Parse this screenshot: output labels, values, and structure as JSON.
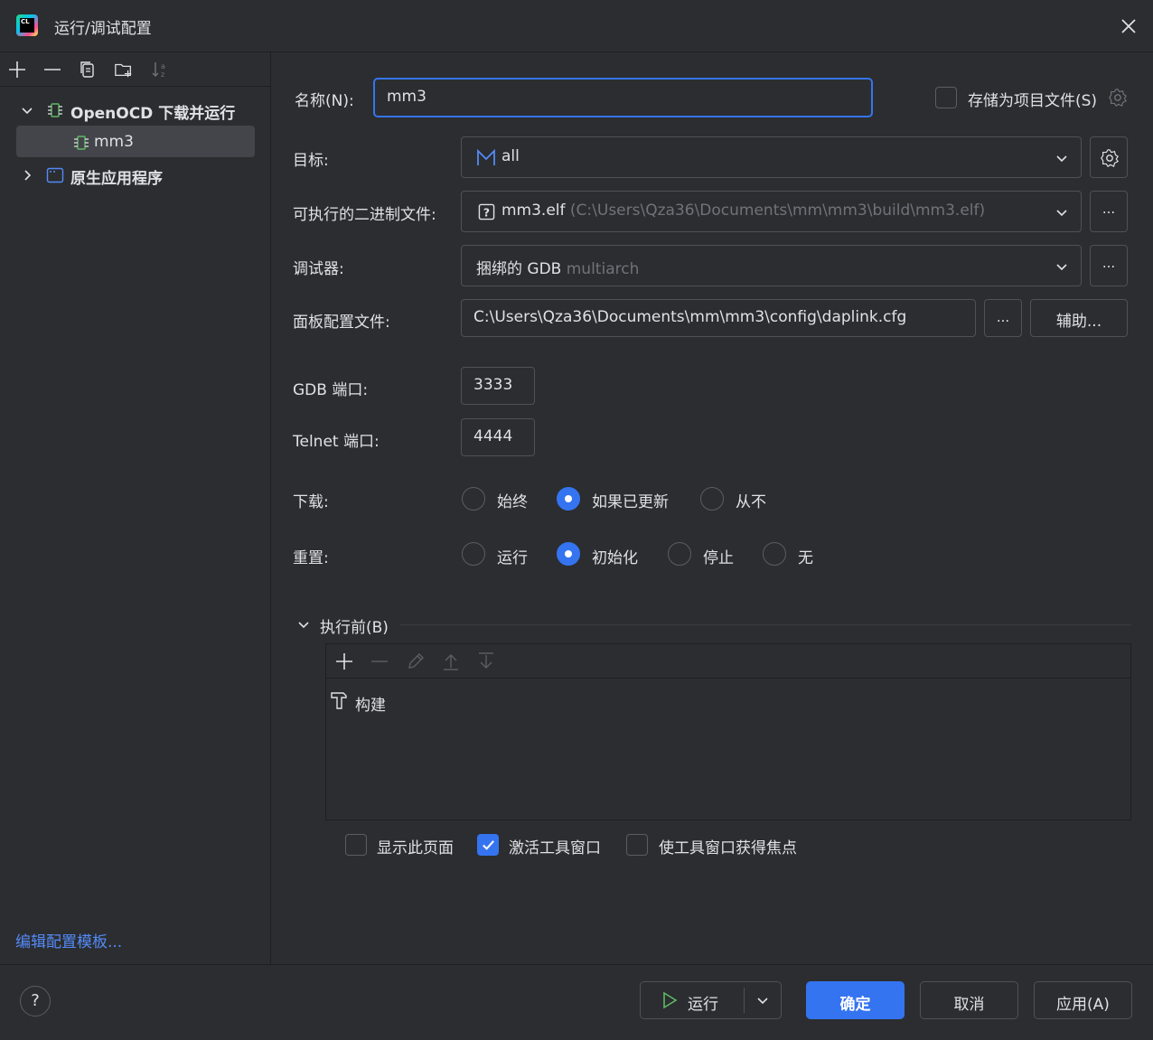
{
  "window": {
    "title": "运行/调试配置",
    "logo_text": "CL"
  },
  "sidebar": {
    "tree": [
      {
        "label": "OpenOCD 下载并运行",
        "expanded": true
      },
      {
        "label": "mm3",
        "selected": true
      },
      {
        "label": "原生应用程序",
        "expanded": false
      }
    ],
    "edit_templates_link": "编辑配置模板..."
  },
  "form": {
    "name_label": "名称(N):",
    "name_value": "mm3",
    "store_as_project_file": "存储为项目文件(S)",
    "target_label": "目标:",
    "target_value": "all",
    "executable_label": "可执行的二进制文件:",
    "executable_value": "mm3.elf",
    "executable_hint": "(C:\\Users\\Qza36\\Documents\\mm\\mm3\\build\\mm3.elf)",
    "debugger_label": "调试器:",
    "debugger_value": "捆绑的 GDB",
    "debugger_hint": "multiarch",
    "board_config_label": "面板配置文件:",
    "board_config_value": "C:\\Users\\Qza36\\Documents\\mm\\mm3\\config\\daplink.cfg",
    "browse_label": "...",
    "assist_label": "辅助...",
    "gdb_port_label": "GDB 端口:",
    "gdb_port_value": "3333",
    "telnet_port_label": "Telnet 端口:",
    "telnet_port_value": "4444",
    "download_label": "下载:",
    "download_options": [
      "始终",
      "如果已更新",
      "从不"
    ],
    "download_selected": "如果已更新",
    "reset_label": "重置:",
    "reset_options": [
      "运行",
      "初始化",
      "停止",
      "无"
    ],
    "reset_selected": "初始化"
  },
  "before_launch": {
    "title": "执行前(B)",
    "tasks": [
      "构建"
    ],
    "checkboxes": [
      {
        "label": "显示此页面",
        "checked": false
      },
      {
        "label": "激活工具窗口",
        "checked": true
      },
      {
        "label": "使工具窗口获得焦点",
        "checked": false
      }
    ]
  },
  "footer": {
    "help": "?",
    "run_label": "运行",
    "ok_label": "确定",
    "cancel_label": "取消",
    "apply_label": "应用(A)"
  },
  "colors": {
    "accent": "#3574f0",
    "link": "#548af7",
    "run_green": "#5fb865",
    "background": "#2b2d30"
  }
}
